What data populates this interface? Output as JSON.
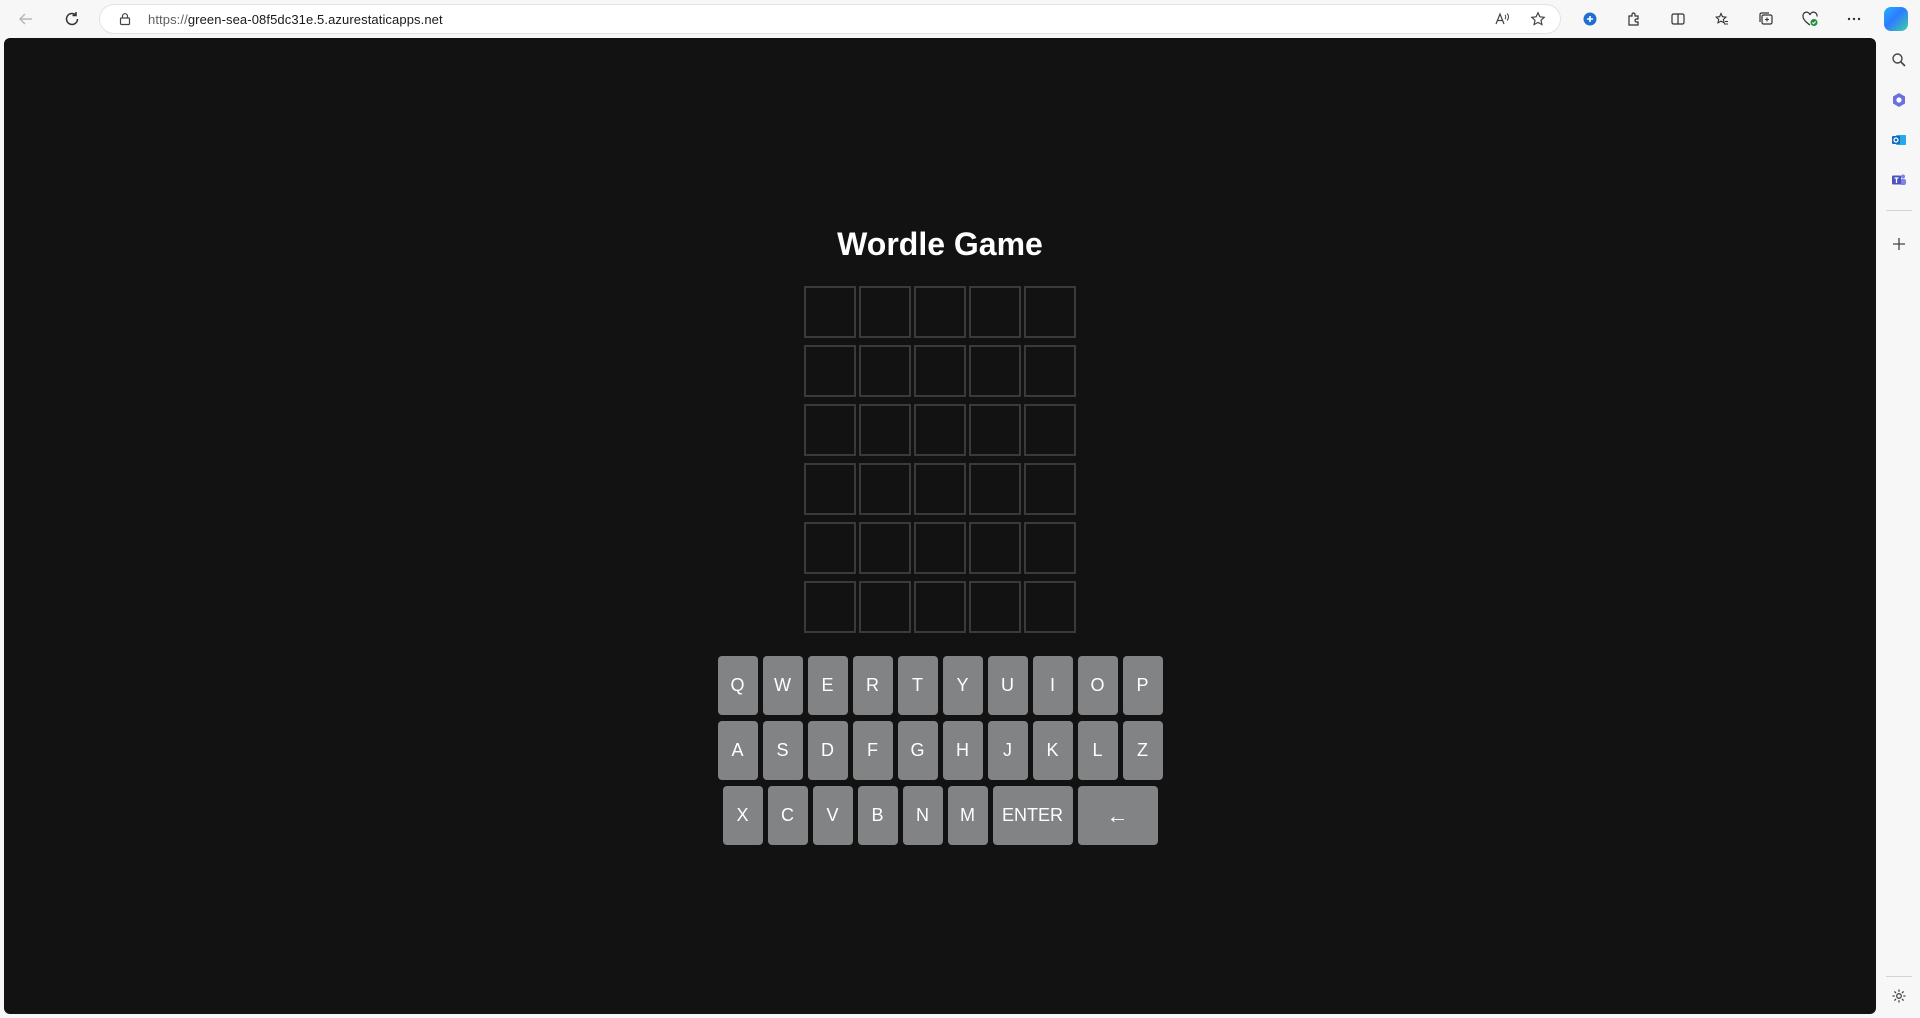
{
  "browser": {
    "url_scheme": "https://",
    "url_host": "green-sea-08f5dc31e.5.azurestaticapps.net",
    "icons": {
      "back": "arrow-left-icon",
      "refresh": "refresh-icon",
      "site_info": "lock-icon",
      "read_aloud": "read-aloud-icon",
      "favorite": "star-icon"
    },
    "toolbar_icons": [
      "extension-icon",
      "puzzle-icon",
      "split-screen-icon",
      "favorites-icon",
      "collections-icon",
      "browser-essentials-icon",
      "more-icon"
    ],
    "sidebar_icons": [
      "search-icon",
      "copilot-icon",
      "outlook-icon",
      "teams-icon",
      "add-icon",
      "settings-icon"
    ]
  },
  "game": {
    "title": "Wordle Game",
    "rows": 6,
    "cols": 5,
    "tile_colors": {
      "border": "#3a3a3c",
      "background": "#121213"
    }
  },
  "keyboard": {
    "rows": [
      [
        "Q",
        "W",
        "E",
        "R",
        "T",
        "Y",
        "U",
        "I",
        "O",
        "P"
      ],
      [
        "A",
        "S",
        "D",
        "F",
        "G",
        "H",
        "J",
        "K",
        "L",
        "Z"
      ],
      [
        "X",
        "C",
        "V",
        "B",
        "N",
        "M",
        "ENTER",
        "←"
      ]
    ],
    "key_color": "#818384",
    "background": "#121213"
  }
}
